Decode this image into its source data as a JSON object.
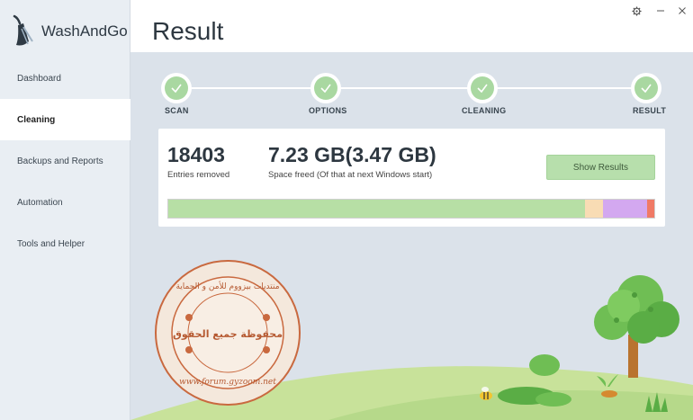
{
  "app": {
    "name": "WashAndGo"
  },
  "sidebar": {
    "items": [
      {
        "label": "Dashboard",
        "active": false
      },
      {
        "label": "Cleaning",
        "active": true
      },
      {
        "label": "Backups and Reports",
        "active": false
      },
      {
        "label": "Automation",
        "active": false
      },
      {
        "label": "Tools and Helper",
        "active": false
      }
    ]
  },
  "header": {
    "title": "Result"
  },
  "stepper": {
    "steps": [
      {
        "label": "SCAN",
        "done": true
      },
      {
        "label": "OPTIONS",
        "done": true
      },
      {
        "label": "CLEANING",
        "done": true
      },
      {
        "label": "RESULT",
        "done": true
      }
    ]
  },
  "result": {
    "entries_value": "18403",
    "entries_label": "Entries removed",
    "space_value": "7.23 GB",
    "space_extra": "(3.47 GB)",
    "space_label": "Space freed (Of that at next Windows start)",
    "show_results_label": "Show Results",
    "bar_segments": [
      {
        "name": "green",
        "fraction": 0.857,
        "color": "#b7dfa5"
      },
      {
        "name": "peach",
        "fraction": 0.037,
        "color": "#f8dcb4"
      },
      {
        "name": "purple",
        "fraction": 0.092,
        "color": "#d3a8f0"
      },
      {
        "name": "red",
        "fraction": 0.014,
        "color": "#f07a66"
      }
    ]
  },
  "watermark": {
    "arabic_line": "منتديات بيزووم للأمن و الحماية",
    "center_text": "محفوظة جميع الحقوق",
    "url": "www.forum.gyzoom.net"
  },
  "colors": {
    "accent_green": "#a9d8a1",
    "sidebar_bg": "#e9eef3",
    "content_bg": "#dbe2ea"
  }
}
